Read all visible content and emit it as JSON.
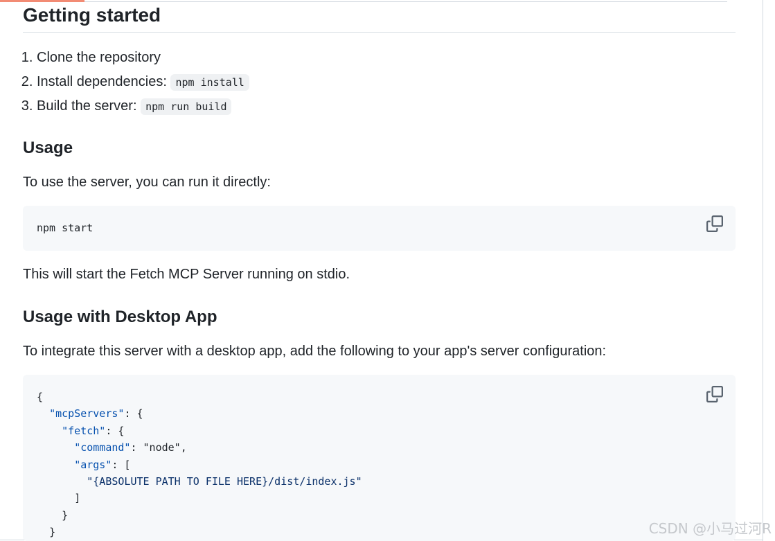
{
  "getting_started": {
    "title": "Getting started",
    "steps": [
      {
        "text": "Clone the repository",
        "code": ""
      },
      {
        "text": "Install dependencies:",
        "code": "npm install"
      },
      {
        "text": "Build the server:",
        "code": "npm run build"
      }
    ]
  },
  "usage": {
    "title": "Usage",
    "intro": "To use the server, you can run it directly:",
    "command": "npm start",
    "outro": "This will start the Fetch MCP Server running on stdio."
  },
  "desktop": {
    "title": "Usage with Desktop App",
    "intro": "To integrate this server with a desktop app, add the following to your app's server configuration:",
    "code_lines": [
      {
        "indent": "",
        "key": "",
        "rest": "{"
      },
      {
        "indent": "  ",
        "key": "\"mcpServers\"",
        "rest": ": {"
      },
      {
        "indent": "    ",
        "key": "\"fetch\"",
        "rest": ": {"
      },
      {
        "indent": "      ",
        "key": "\"command\"",
        "rest": ": \"node\","
      },
      {
        "indent": "      ",
        "key": "\"args\"",
        "rest": ": ["
      },
      {
        "indent": "        ",
        "key": "",
        "str": "\"{ABSOLUTE PATH TO FILE HERE}/dist/index.js\"",
        "rest": ""
      },
      {
        "indent": "      ",
        "key": "",
        "rest": "]"
      },
      {
        "indent": "    ",
        "key": "",
        "rest": "}"
      },
      {
        "indent": "  ",
        "key": "",
        "rest": "}"
      }
    ]
  },
  "copy_icon": "copy-icon",
  "watermark": "CSDN @小马过河R",
  "colors": {
    "accent": "#f28b74",
    "code_bg": "#f6f8fa",
    "json_key": "#0550ae"
  }
}
